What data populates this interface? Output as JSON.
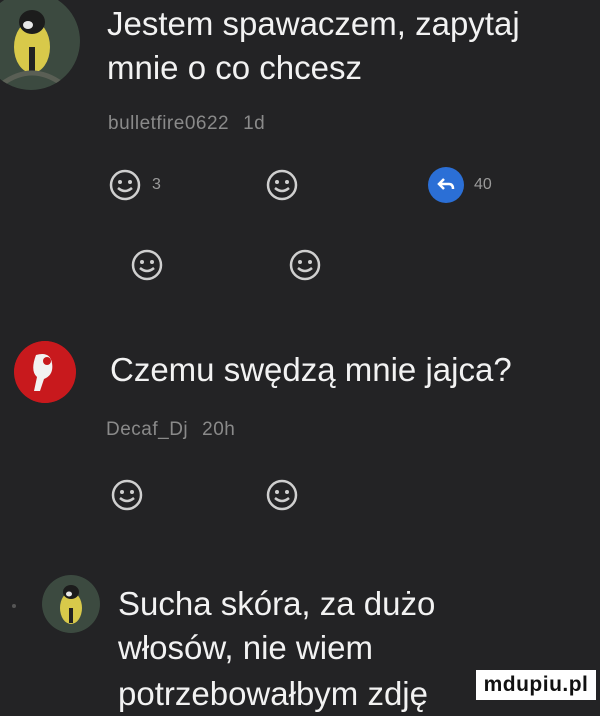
{
  "comments": [
    {
      "text_lines": [
        "Jestem spawaczem, zapytaj",
        "mnie o co chcesz"
      ],
      "username": "bulletfire0622",
      "time": "1d",
      "reactions": [
        {
          "icon": "smiley-icon",
          "count": "3"
        },
        {
          "icon": "smiley-icon",
          "count": ""
        },
        {
          "icon": "reply-icon",
          "count": "40"
        },
        {
          "icon": "smiley-icon",
          "count": ""
        },
        {
          "icon": "smiley-icon",
          "count": ""
        }
      ]
    },
    {
      "text_lines": [
        "Czemu swędzą mnie jajca?"
      ],
      "username": "Decaf_Dj",
      "time": "20h",
      "reactions": [
        {
          "icon": "smiley-icon",
          "count": ""
        },
        {
          "icon": "smiley-icon",
          "count": ""
        }
      ]
    },
    {
      "text_lines": [
        "Sucha skóra, za dużo",
        "włosów, nie wiem",
        "potrzebowałbym zdję"
      ],
      "username": "",
      "time": "",
      "reactions": []
    }
  ],
  "watermark": "mdupiu.pl",
  "colors": {
    "background": "#232325",
    "reply_badge": "#2b6fd6",
    "avatar_red": "#c8191d"
  }
}
